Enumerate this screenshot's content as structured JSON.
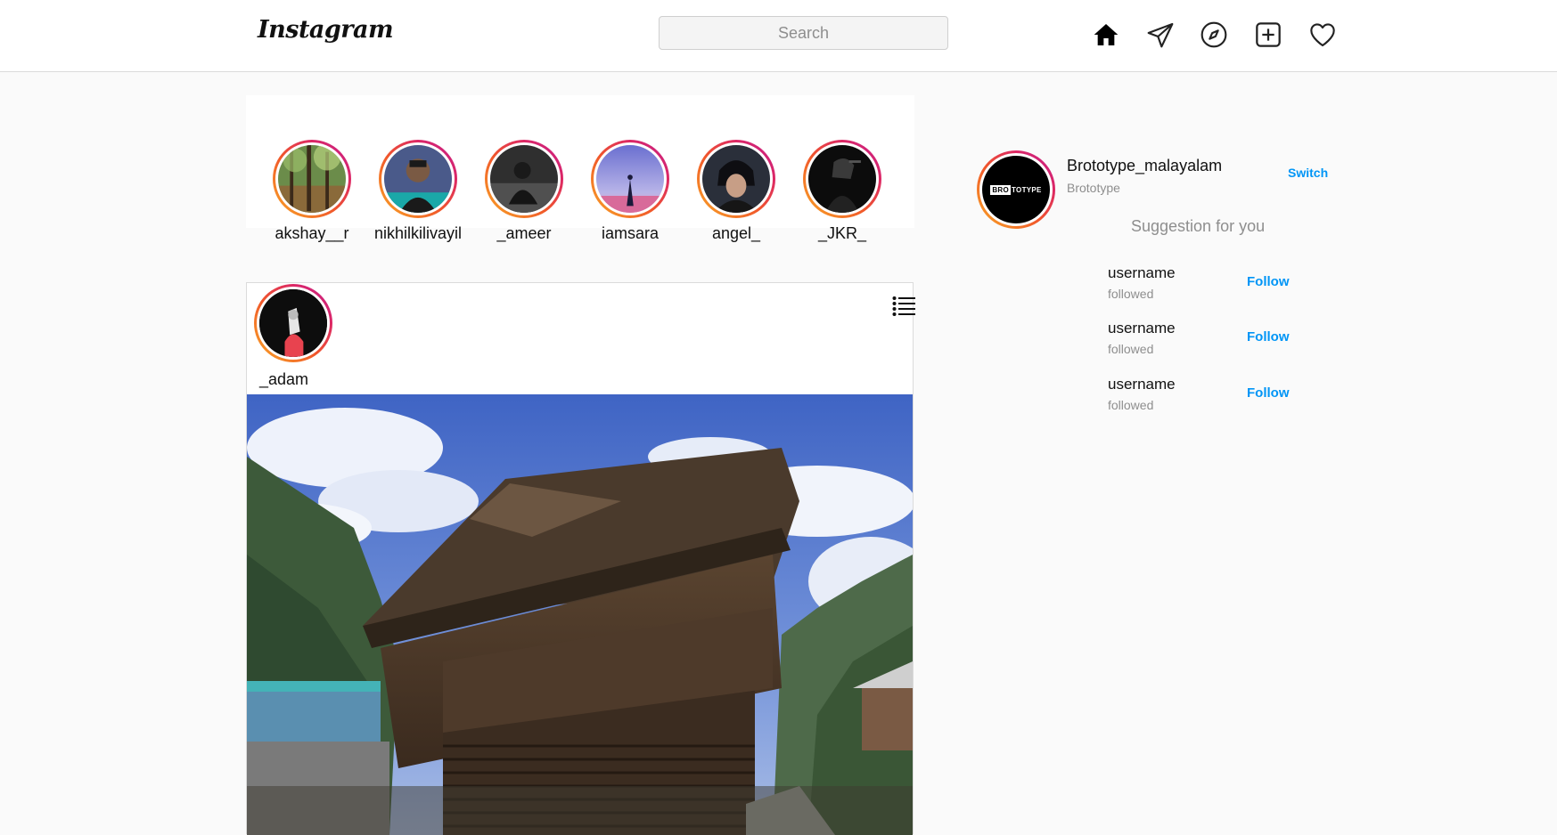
{
  "header": {
    "logo": "Instagram",
    "search_placeholder": "Search",
    "icons": [
      "home-icon",
      "paper-plane-icon",
      "compass-icon",
      "new-post-icon",
      "heart-icon"
    ]
  },
  "stories": [
    {
      "username": "akshay__r"
    },
    {
      "username": "nikhilkilivayil"
    },
    {
      "username": "_ameer"
    },
    {
      "username": "iamsara"
    },
    {
      "username": "angel_"
    },
    {
      "username": "_JKR_"
    }
  ],
  "post": {
    "username": "_adam",
    "menu_icon": "list-menu-icon"
  },
  "sidebar": {
    "profile_name": "Brototype_malayalam",
    "profile_sub": "Brototype",
    "profile_logo": {
      "boxed": "BRO",
      "rest": "TOTYPE"
    },
    "switch_label": "Switch",
    "suggestion_title": "Suggestion for you",
    "suggestions": [
      {
        "username": "username",
        "sub": "followed",
        "action": "Follow"
      },
      {
        "username": "username",
        "sub": "followed",
        "action": "Follow"
      },
      {
        "username": "username",
        "sub": "followed",
        "action": "Follow"
      }
    ]
  },
  "colors": {
    "accent": "#0095f6",
    "ring_start": "#f9a825",
    "ring_end": "#c1208e",
    "background": "#fafafa"
  }
}
